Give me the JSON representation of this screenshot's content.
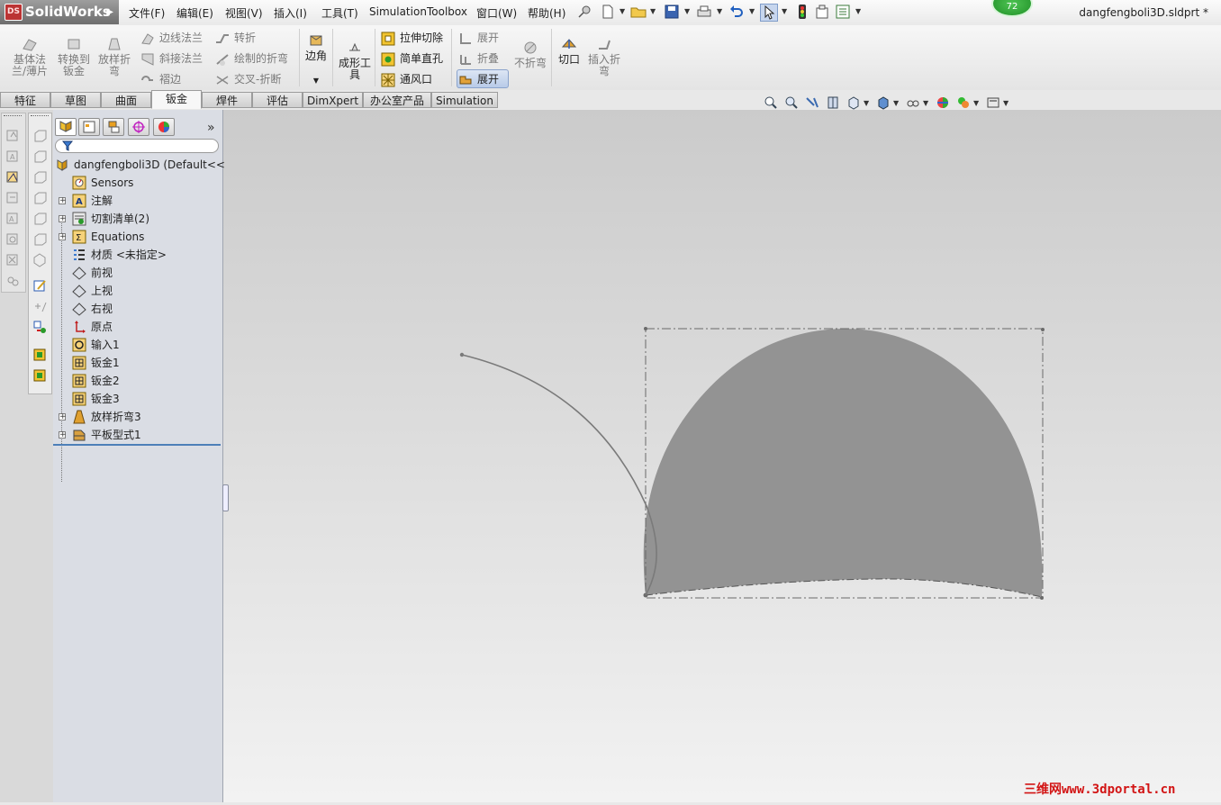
{
  "app": {
    "name": "SolidWorks",
    "logo_badge": "DS"
  },
  "menu": [
    "文件(F)",
    "编辑(E)",
    "视图(V)",
    "插入(I)",
    "工具(T)",
    "Simulation",
    "Toolbox",
    "窗口(W)",
    "帮助(H)"
  ],
  "rebuild_badge": "72",
  "document_title": "dangfengboli3D.sldprt *",
  "sheetmetal_commands": {
    "base_flange": "基体法兰/薄片",
    "convert_to_sheetmetal": "转换到钣金",
    "lofted_bend": "放样折弯",
    "edge_flange": "边线法兰",
    "miter_flange": "斜接法兰",
    "hem": "褶边",
    "jog": "转折",
    "sketched_bend": "绘制的折弯",
    "cross_break": "交叉-折断",
    "corners": "边角",
    "forming_tool": "成形工具",
    "extruded_cut": "拉伸切除",
    "simple_hole": "简单直孔",
    "vent": "通风口",
    "unfold": "展开",
    "fold": "折叠",
    "flatten": "展开",
    "no_bends": "不折弯",
    "rip": "切口",
    "insert_bends": "插入折弯"
  },
  "tabs": [
    "特征",
    "草图",
    "曲面",
    "钣金",
    "焊件",
    "评估",
    "DimXpert",
    "办公室产品",
    "Simulation"
  ],
  "active_tab": "钣金",
  "feature_tree": {
    "root": "dangfengboli3D  (Default<<",
    "items": [
      "Sensors",
      "注解",
      "切割清单(2)",
      "Equations",
      "材质 <未指定>",
      "前视",
      "上视",
      "右视",
      "原点",
      "输入1",
      "钣金1",
      "钣金2",
      "钣金3",
      "放样折弯3",
      "平板型式1"
    ]
  },
  "watermark": "三维网www.3dportal.cn",
  "colors": {
    "part_face": "#939393",
    "accent_blue": "#4d7fb8",
    "watermark": "#d21414"
  }
}
